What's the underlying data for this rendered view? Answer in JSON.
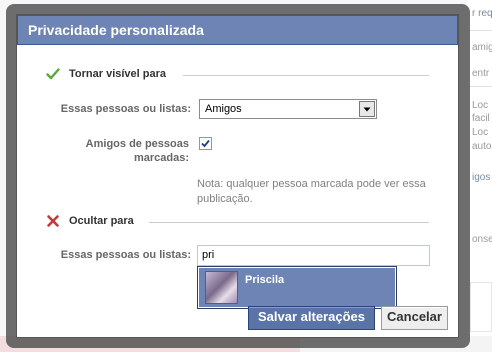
{
  "background": {
    "fragments": [
      "r req",
      "amig",
      "entr",
      "Loc",
      "facil",
      "Loc",
      "auto",
      "igos",
      "onse"
    ]
  },
  "dialog": {
    "title": "Privacidade personalizada",
    "visible_section": {
      "title": "Tornar visível para",
      "icon": "green-checkmark-icon",
      "people_label": "Essas pessoas ou listas:",
      "people_select_value": "Amigos",
      "tagged_label": "Amigos de pessoas marcadas:",
      "tagged_checked": true,
      "note": "Nota: qualquer pessoa marcada pode ver essa publicação."
    },
    "hide_section": {
      "title": "Ocultar para",
      "icon": "red-x-icon",
      "people_label": "Essas pessoas ou listas:",
      "input_value": "pri",
      "suggestions": [
        {
          "name": "Priscila",
          "avatar": "profile-photo"
        }
      ]
    },
    "buttons": {
      "save": "Salvar alterações",
      "cancel": "Cancelar"
    }
  },
  "colors": {
    "header_blue": "#6d84b4",
    "button_blue": "#5b74a8",
    "check_green": "#5aa83c",
    "x_red": "#c23b3b"
  }
}
